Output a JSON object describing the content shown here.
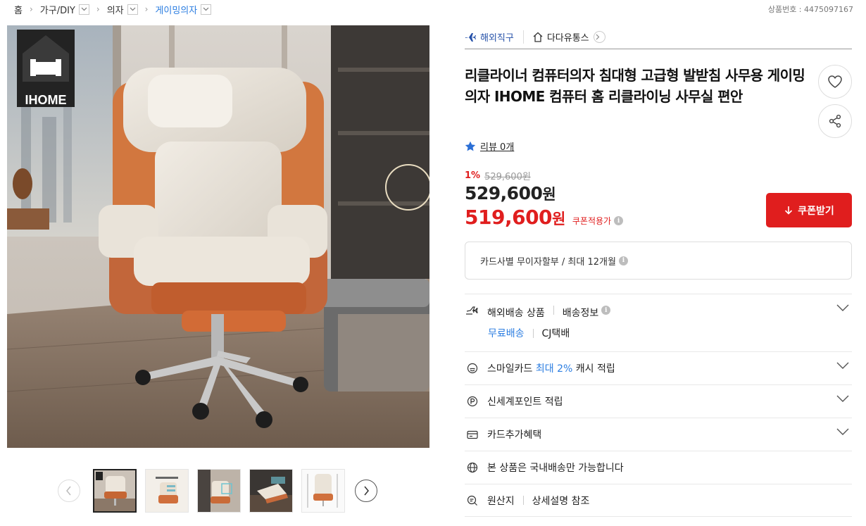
{
  "breadcrumb": {
    "home": "홈",
    "items": [
      {
        "label": "가구/DIY"
      },
      {
        "label": "의자"
      },
      {
        "label": "게이밍의자"
      }
    ]
  },
  "product_number": {
    "label": "상품번호 : 4475097167"
  },
  "gallery": {
    "logo_text": "IHOME",
    "thumb_count": 5,
    "selected_index": 0
  },
  "seller": {
    "overseas_direct": "해외직구",
    "shop_name": "다다유통스"
  },
  "product": {
    "title": "리클라이너 컴퓨터의자 침대형 고급형 발받침 사무용 게이밍 의자 IHOME 컴퓨터 홈 리클라이닝 사무실 편안",
    "review_label": "리뷰 0개"
  },
  "price": {
    "discount_pct": "1%",
    "original": "529,600원",
    "sale_value": "529,600",
    "coupon_value": "519,600",
    "won": "원",
    "coupon_applied_label": "쿠폰적용가",
    "coupon_button": "쿠폰받기"
  },
  "installment": {
    "label": "카드사별 무이자할부 / 최대 12개월"
  },
  "benefits": {
    "shipping_type": "해외배송 상품",
    "shipping_info": "배송정보",
    "free_shipping": "무료배송",
    "courier": "CJ택배",
    "smilecard_prefix": "스마일카드",
    "smilecard_highlight": "최대 2%",
    "smilecard_suffix": "캐시 적립",
    "shinsegae_points": "신세계포인트 적립",
    "card_benefits": "카드추가혜택",
    "domestic_only": "본 상품은 국내배송만 가능합니다",
    "origin_label": "원산지",
    "origin_value": "상세설명 참조"
  },
  "colors": {
    "accent_red": "#e01e1e",
    "link_blue": "#2b7de1",
    "seller_blue": "#2450a8"
  },
  "icons": [
    "chevron-right-icon",
    "chevron-down-icon",
    "airplane-icon",
    "home-icon",
    "heart-icon",
    "share-icon",
    "star-icon",
    "download-icon",
    "info-icon",
    "shipping-icon",
    "smile-card-icon",
    "point-icon",
    "card-icon",
    "globe-icon",
    "search-doc-icon"
  ]
}
